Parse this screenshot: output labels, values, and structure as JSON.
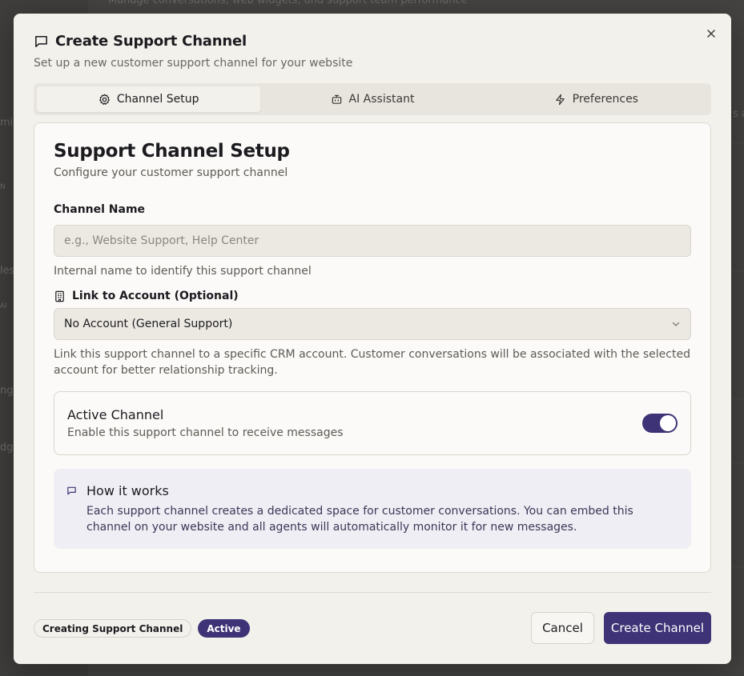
{
  "background": {
    "top_text": "Manage conversations, web widgets, and support team performance",
    "fragments": [
      "mis",
      "N",
      "les",
      "AI",
      "ng",
      "dge",
      "s a"
    ]
  },
  "dialog": {
    "title": "Create Support Channel",
    "subtitle": "Set up a new customer support channel for your website",
    "close_icon": "close-icon"
  },
  "tabs": [
    {
      "label": "Channel Setup",
      "icon": "gear-icon",
      "active": true
    },
    {
      "label": "AI Assistant",
      "icon": "bot-icon",
      "active": false
    },
    {
      "label": "Preferences",
      "icon": "lightning-icon",
      "active": false
    }
  ],
  "card": {
    "title": "Support Channel Setup",
    "description": "Configure your customer support channel"
  },
  "channel_name": {
    "label": "Channel Name",
    "value": "",
    "placeholder": "e.g., Website Support, Help Center",
    "help": "Internal name to identify this support channel"
  },
  "account": {
    "label": "Link to Account (Optional)",
    "selected": "No Account (General Support)",
    "help": "Link this support channel to a specific CRM account. Customer conversations will be associated with the selected account for better relationship tracking."
  },
  "active_channel": {
    "title": "Active Channel",
    "description": "Enable this support channel to receive messages",
    "enabled": true
  },
  "how_it_works": {
    "title": "How it works",
    "text": "Each support channel creates a dedicated space for customer conversations. You can embed this channel on your website and all agents will automatically monitor it for new messages."
  },
  "footer": {
    "status_chip": "Creating Support Channel",
    "active_chip": "Active",
    "cancel_label": "Cancel",
    "create_label": "Create Channel"
  },
  "colors": {
    "accent": "#3d3376",
    "dialog_bg": "#f3f1ec",
    "info_bg": "#efeef4"
  }
}
